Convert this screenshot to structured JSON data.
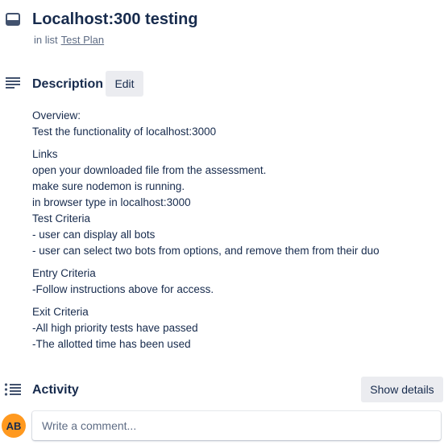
{
  "card": {
    "title": "Localhost:300 testing",
    "in_list_prefix": "in list",
    "list_name": "Test Plan"
  },
  "description": {
    "heading": "Description",
    "edit_label": "Edit",
    "paragraphs": [
      [
        "Overview:",
        "Test the functionality of localhost:3000"
      ],
      [
        "Links",
        "open your downloaded file from the assessment.",
        "make sure nodemon is running.",
        "in browser type in localhost:3000",
        "Test Criteria",
        "- user can display all bots",
        "- user can select two bots from options, and remove them from their duo"
      ],
      [
        "Entry Criteria",
        "-Follow instructions above for access."
      ],
      [
        "Exit Criteria",
        "-All high priority tests have passed",
        "-The allotted time has been used"
      ]
    ]
  },
  "activity": {
    "heading": "Activity",
    "show_details_label": "Show details",
    "avatar_initials": "AB",
    "comment_placeholder": "Write a comment..."
  },
  "icons": {
    "card": "card-icon",
    "description": "description-lines-icon",
    "activity": "activity-list-icon"
  },
  "colors": {
    "text": "#172b4d",
    "muted": "#5e6c84",
    "button_bg": "#ebecf0",
    "avatar_bg": "#ff991f"
  }
}
